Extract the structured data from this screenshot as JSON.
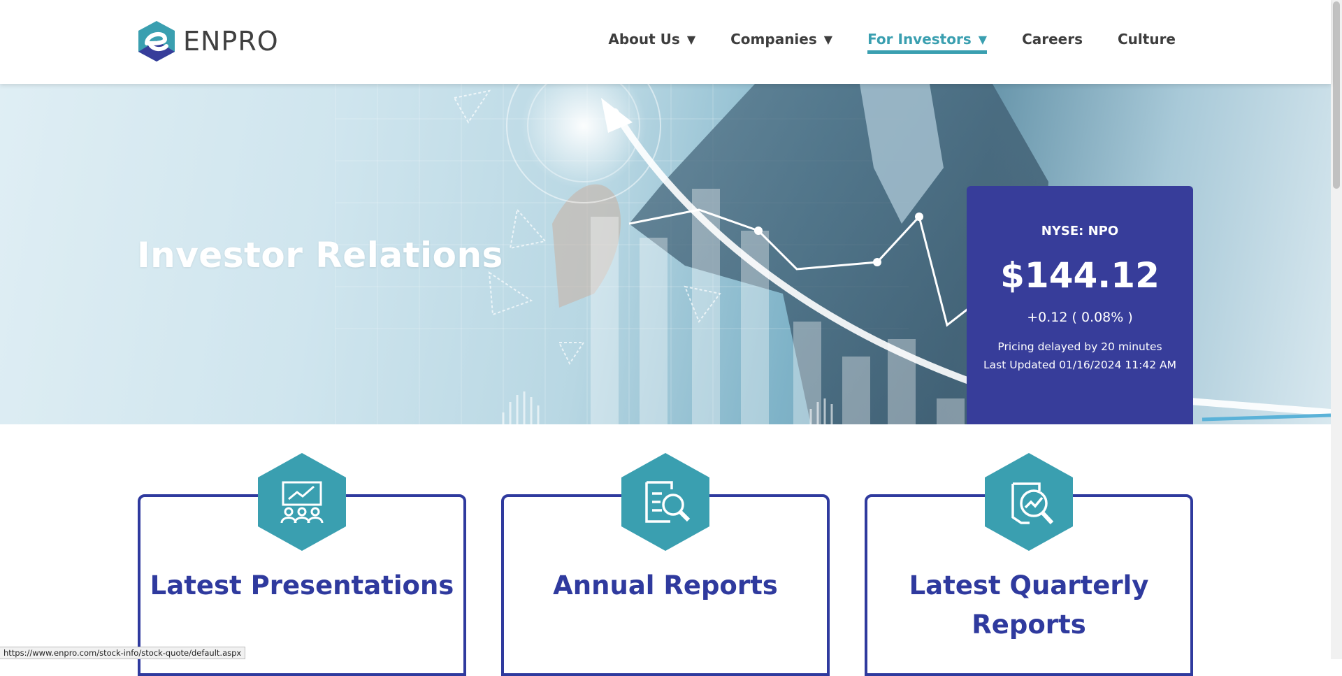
{
  "brand": {
    "name": "ENPRO"
  },
  "nav": {
    "items": [
      {
        "label": "About Us",
        "caret": "▼"
      },
      {
        "label": "Companies",
        "caret": "▼"
      },
      {
        "label": "For Investors",
        "caret": "▼"
      },
      {
        "label": "Careers"
      },
      {
        "label": "Culture"
      }
    ]
  },
  "hero": {
    "title": "Investor Relations"
  },
  "quote": {
    "symbol": "NYSE: NPO",
    "price": "$144.12",
    "change": "+0.12 ( 0.08% )",
    "delay_note": "Pricing delayed by 20 minutes",
    "last_updated": "Last Updated 01/16/2024 11:42 AM"
  },
  "cards": [
    {
      "title": "Latest Presentations",
      "icon": "presentation-icon"
    },
    {
      "title": "Annual Reports",
      "icon": "report-search-icon"
    },
    {
      "title": "Latest Quarterly Reports",
      "icon": "chart-search-icon"
    }
  ],
  "status_url": "https://www.enpro.com/stock-info/stock-quote/default.aspx",
  "colors": {
    "teal": "#3a9fb0",
    "navy": "#373d9a",
    "card_border": "#2f3a9e"
  }
}
